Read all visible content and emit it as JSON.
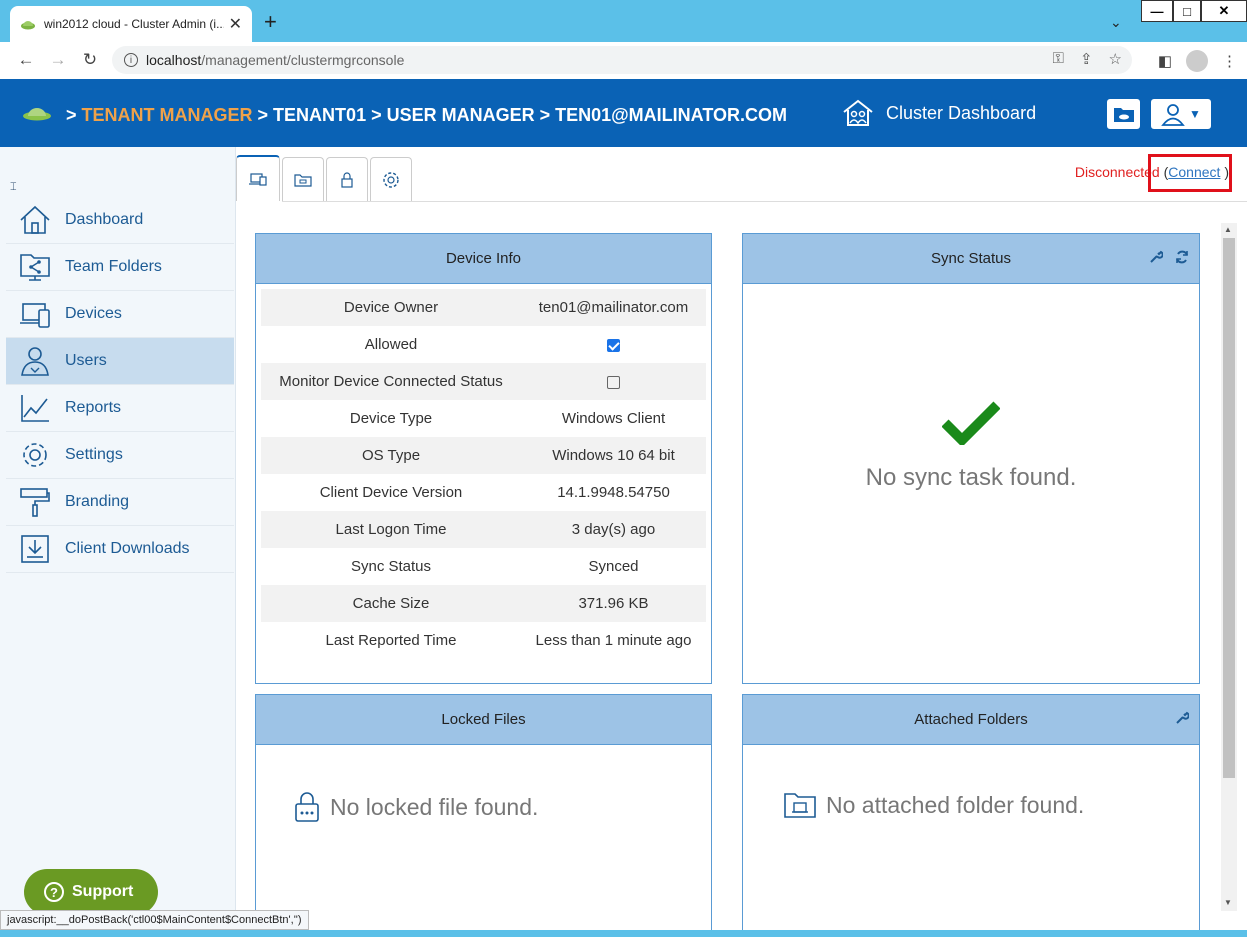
{
  "browser": {
    "tab_title": "win2012 cloud - Cluster Admin (i...",
    "tab_close": "✕",
    "new_tab": "+",
    "tab_menu": "⌄",
    "win_min": "—",
    "win_max": "□",
    "win_close": "✕",
    "url_host": "localhost",
    "url_path": "/management/clustermgrconsole",
    "status_url": "javascript:__doPostBack('ctl00$MainContent$ConnectBtn','')"
  },
  "header": {
    "sep1": ">",
    "tenant_manager": "TENANT MANAGER",
    "crumb_rest": "> TENANT01  > USER MANAGER >  TEN01@MAILINATOR.COM",
    "dashboard": "Cluster Dashboard"
  },
  "sidebar": {
    "items": [
      {
        "label": "Dashboard"
      },
      {
        "label": "Team Folders"
      },
      {
        "label": "Devices"
      },
      {
        "label": "Users"
      },
      {
        "label": "Reports"
      },
      {
        "label": "Settings"
      },
      {
        "label": "Branding"
      },
      {
        "label": "Client Downloads"
      }
    ],
    "support": "Support"
  },
  "status": {
    "disconnected": "Disconnected",
    "open_paren": " (",
    "connect": "Connect",
    "close_paren": " )"
  },
  "device_info": {
    "title": "Device Info",
    "rows": [
      {
        "key": "Device Owner",
        "value": "ten01@mailinator.com"
      },
      {
        "key": "Allowed",
        "value": ""
      },
      {
        "key": "Monitor Device Connected Status",
        "value": ""
      },
      {
        "key": "Device Type",
        "value": "Windows Client"
      },
      {
        "key": "OS Type",
        "value": "Windows 10 64 bit"
      },
      {
        "key": "Client Device Version",
        "value": "14.1.9948.54750"
      },
      {
        "key": "Last Logon Time",
        "value": "3 day(s) ago"
      },
      {
        "key": "Sync Status",
        "value": "Synced"
      },
      {
        "key": "Cache Size",
        "value": "371.96 KB"
      },
      {
        "key": "Last Reported Time",
        "value": "Less than 1 minute ago"
      }
    ],
    "allowed_checked": true,
    "monitor_checked": false
  },
  "sync_status": {
    "title": "Sync Status",
    "message": "No sync task found."
  },
  "locked_files": {
    "title": "Locked Files",
    "message": "No locked file found."
  },
  "attached_folders": {
    "title": "Attached Folders",
    "message": "No attached folder found."
  },
  "colors": {
    "header_blue": "#0a62b5",
    "accent_orange": "#f0a24a",
    "panel_head": "#9dc3e6",
    "disconnected_red": "#e02020",
    "success_green": "#1a8a1a",
    "support_green": "#6a9a23"
  }
}
